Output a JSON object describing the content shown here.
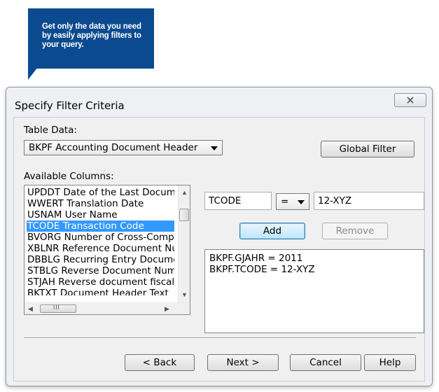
{
  "callout": {
    "text": "Get only the data you need by easily applying filters to your query.",
    "color": "#0b4a8f"
  },
  "dialog": {
    "title": "Specify Filter Criteria",
    "close_icon": "close-icon",
    "table_data_label": "Table Data:",
    "table_value": "BKPF Accounting Document Header",
    "global_filter_label": "Global Filter",
    "available_columns_label": "Available Columns:",
    "columns": [
      "UPDDT Date of the Last Document Change",
      "WWERT Translation Date",
      "USNAM User Name",
      "TCODE Transaction Code",
      "BVORG Number of Cross-Company Code Posting Transaction",
      "XBLNR Reference Document Number",
      "DBBLG Recurring Entry Document Number",
      "STBLG Reverse Document Number",
      "STJAH Reverse document fiscal year",
      "BKTXT Document Header Text"
    ],
    "selected_column": "TCODE Transaction Code",
    "field_value": "TCODE",
    "operator_value": "=",
    "filter_value": "12-XYZ",
    "add_label": "Add",
    "remove_label": "Remove",
    "criteria": [
      "BKPF.GJAHR = 2011",
      "BKPF.TCODE = 12-XYZ"
    ],
    "back_label": "< Back",
    "next_label": "Next >",
    "cancel_label": "Cancel",
    "help_label": "Help",
    "hscroll_thumb_glyph": "III"
  }
}
